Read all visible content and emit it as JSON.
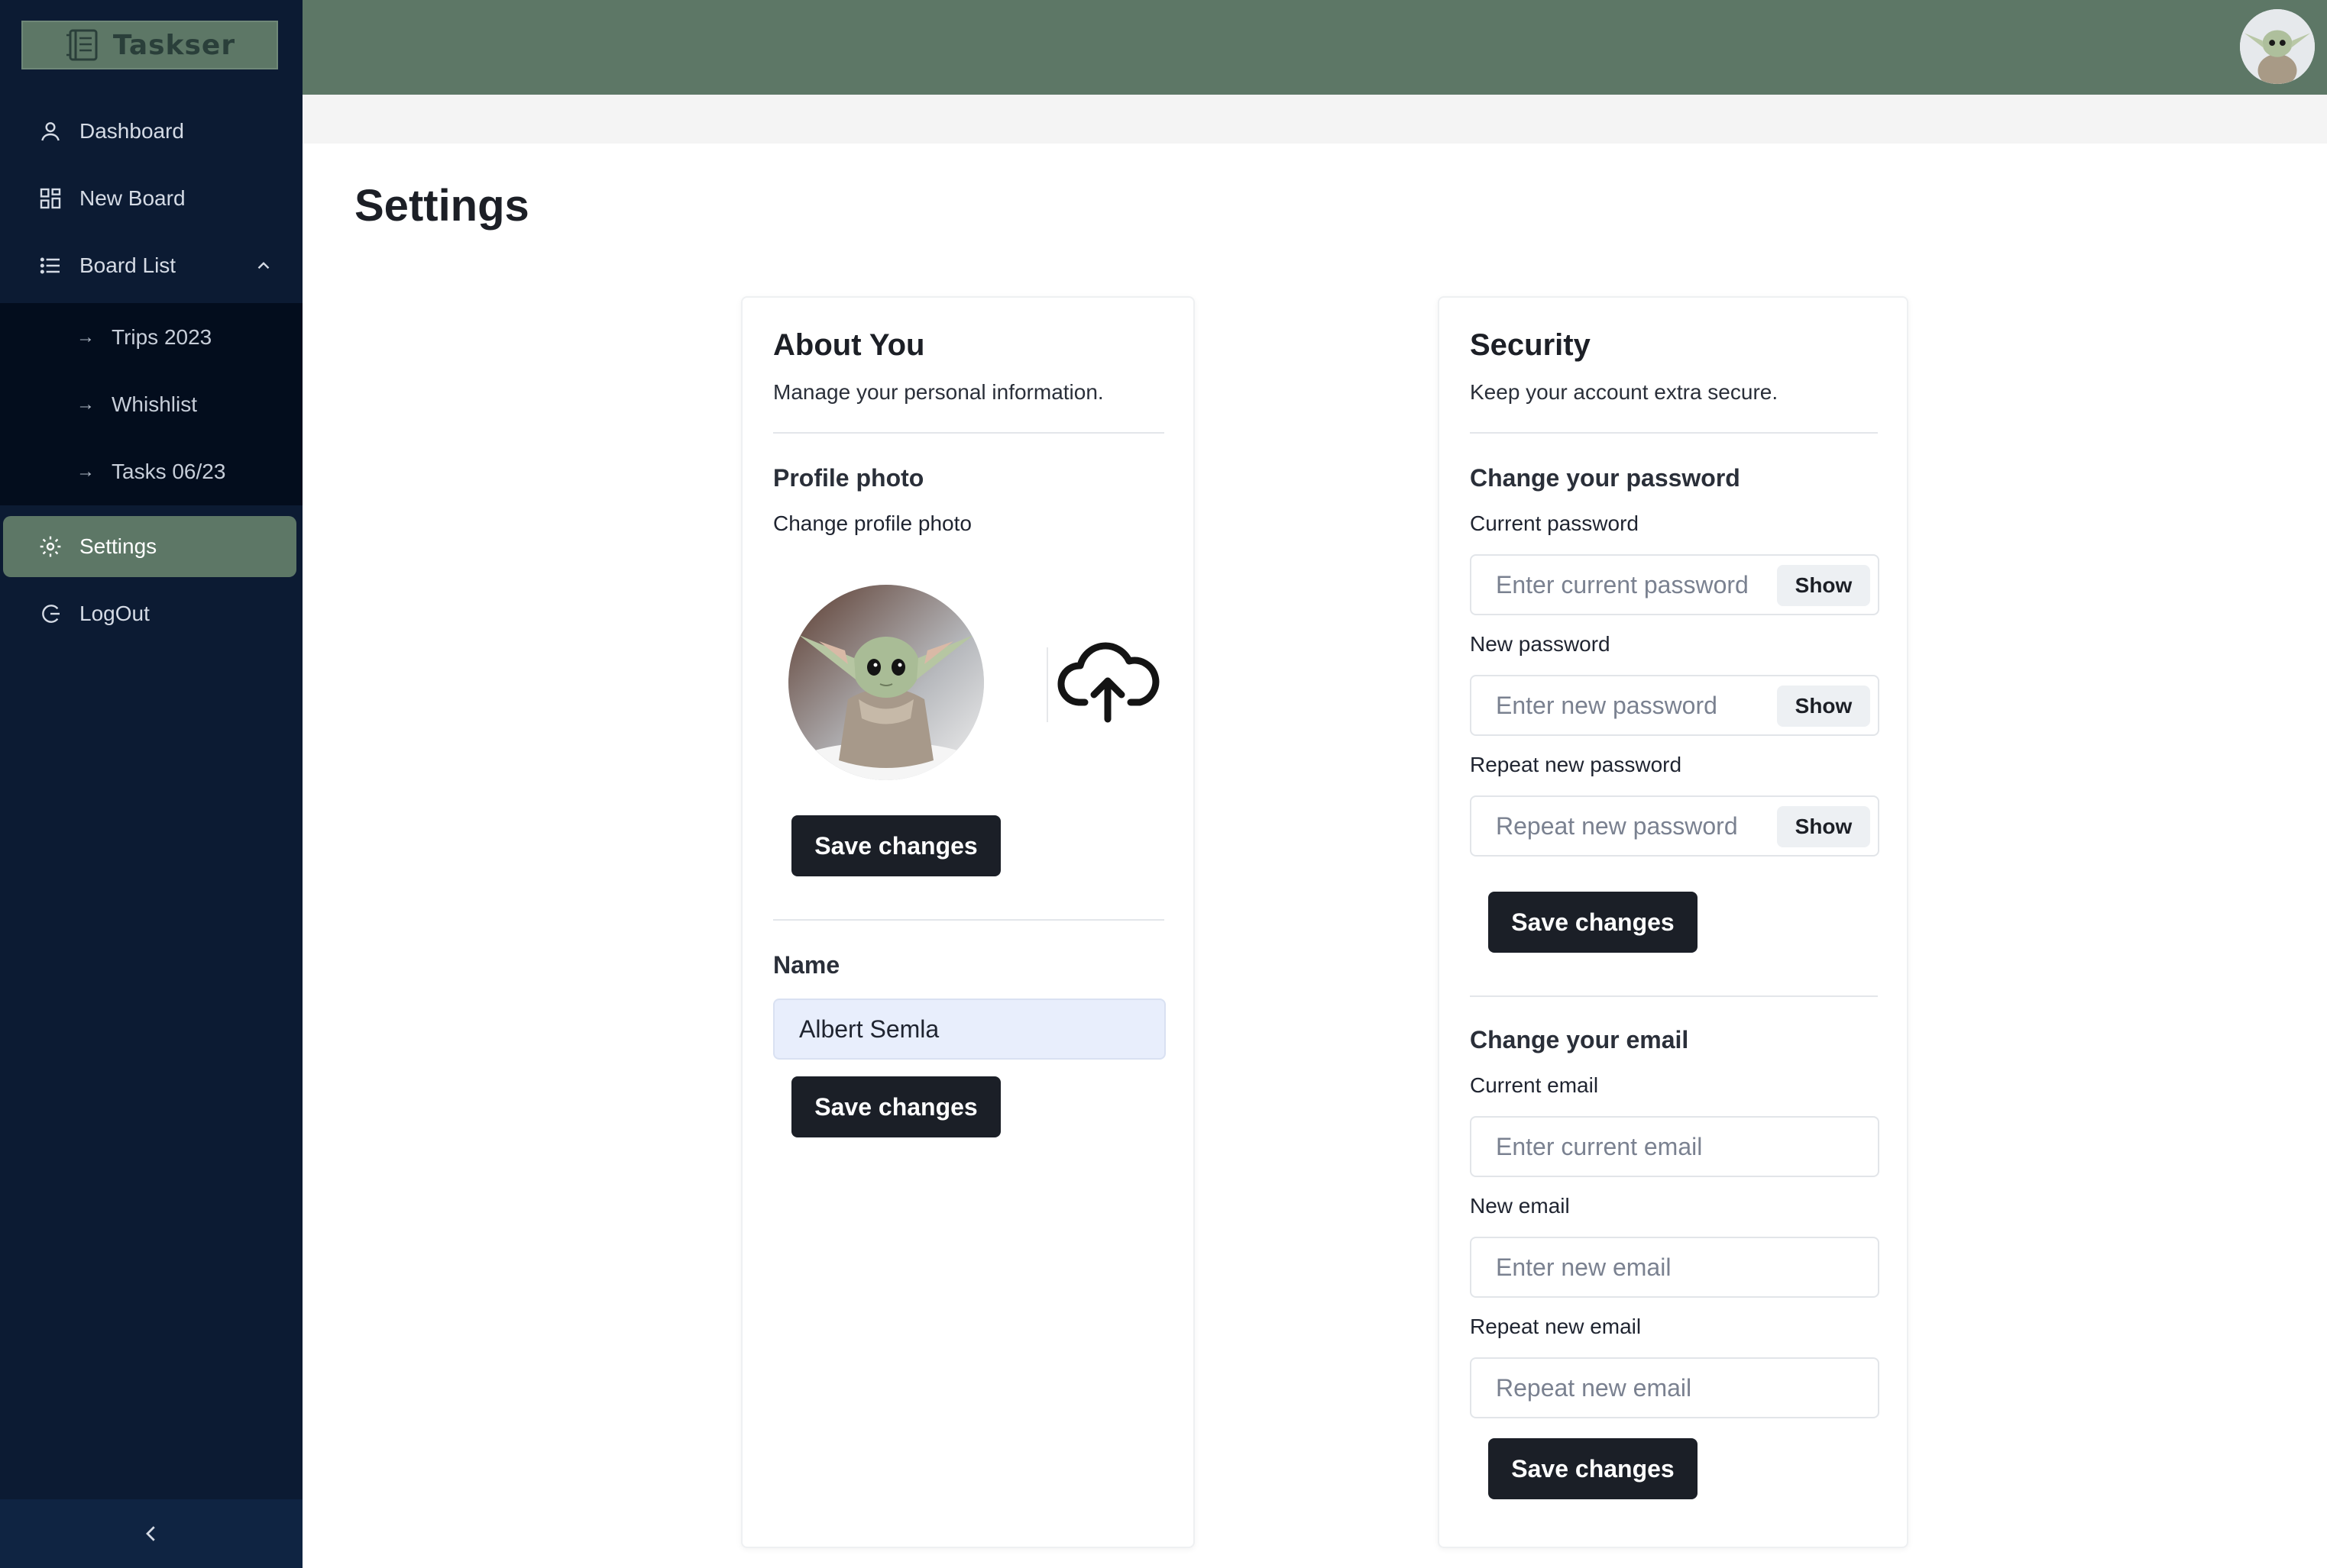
{
  "app": {
    "name": "Taskser"
  },
  "sidebar": {
    "items": [
      {
        "label": "Dashboard",
        "icon": "user-icon"
      },
      {
        "label": "New Board",
        "icon": "board-icon"
      },
      {
        "label": "Board List",
        "icon": "list-icon"
      },
      {
        "label": "Settings",
        "icon": "gear-icon"
      },
      {
        "label": "LogOut",
        "icon": "logout-icon"
      }
    ],
    "board_list": [
      {
        "label": "Trips 2023"
      },
      {
        "label": "Whishlist"
      },
      {
        "label": "Tasks 06/23"
      }
    ],
    "arrow_glyph": "→"
  },
  "page": {
    "title": "Settings"
  },
  "about": {
    "title": "About You",
    "description": "Manage your personal information.",
    "photo_heading": "Profile photo",
    "photo_label": "Change profile photo",
    "save_photo": "Save changes",
    "name_label": "Name",
    "name_value": "Albert Semla",
    "save_name": "Save changes"
  },
  "security": {
    "title": "Security",
    "description": "Keep your account extra secure.",
    "password_heading": "Change your password",
    "current_password_label": "Current password",
    "current_password_placeholder": "Enter current password",
    "new_password_label": "New password",
    "new_password_placeholder": "Enter new password",
    "repeat_password_label": "Repeat new password",
    "repeat_password_placeholder": "Repeat new password",
    "show_label": "Show",
    "save_password": "Save changes",
    "email_heading": "Change your email",
    "current_email_label": "Current email",
    "current_email_placeholder": "Enter current email",
    "new_email_label": "New email",
    "new_email_placeholder": "Enter new email",
    "repeat_email_label": "Repeat new email",
    "repeat_email_placeholder": "Repeat new email",
    "save_email": "Save changes"
  },
  "colors": {
    "sidebar_bg": "#0c1b33",
    "accent": "#5d7766",
    "button": "#1b1f27"
  }
}
